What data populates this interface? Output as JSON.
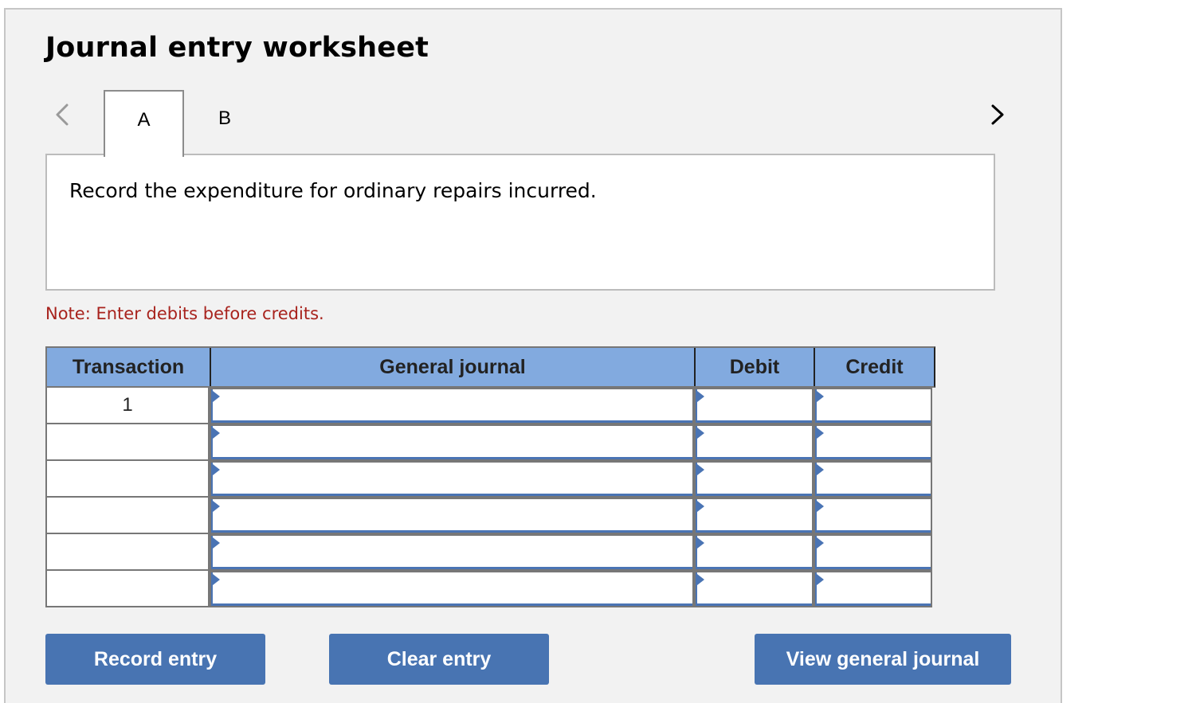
{
  "worksheet": {
    "title": "Journal entry worksheet",
    "nav": {
      "prev_icon": "chevron-left-icon",
      "next_icon": "chevron-right-icon"
    },
    "tabs": [
      {
        "label": "A",
        "active": true
      },
      {
        "label": "B",
        "active": false
      }
    ],
    "prompt": "Record the expenditure for ordinary repairs incurred.",
    "note": "Note: Enter debits before credits.",
    "colors": {
      "header_bg": "#82aadf",
      "button_bg": "#4874b2",
      "note_text": "#a8231d",
      "input_accent": "#4a74b4"
    }
  },
  "journal": {
    "columns": [
      "Transaction",
      "General journal",
      "Debit",
      "Credit"
    ],
    "rows": [
      {
        "transaction": "1",
        "general_journal": "",
        "debit": "",
        "credit": ""
      },
      {
        "transaction": "",
        "general_journal": "",
        "debit": "",
        "credit": ""
      },
      {
        "transaction": "",
        "general_journal": "",
        "debit": "",
        "credit": ""
      },
      {
        "transaction": "",
        "general_journal": "",
        "debit": "",
        "credit": ""
      },
      {
        "transaction": "",
        "general_journal": "",
        "debit": "",
        "credit": ""
      },
      {
        "transaction": "",
        "general_journal": "",
        "debit": "",
        "credit": ""
      }
    ]
  },
  "buttons": {
    "record": "Record entry",
    "clear": "Clear entry",
    "view": "View general journal"
  }
}
